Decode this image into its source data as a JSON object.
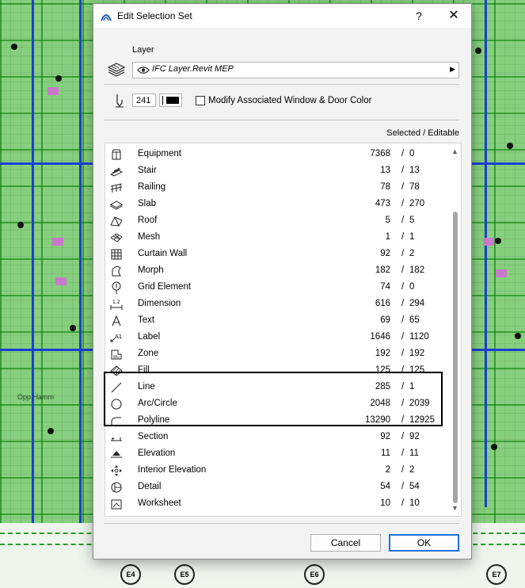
{
  "dialog": {
    "title": "Edit Selection Set",
    "help_label": "?",
    "close_label": "✕"
  },
  "layer": {
    "heading": "Layer",
    "value": "IFC Layer.Revit MEP"
  },
  "pen": {
    "number": "241",
    "checkbox_label": "Modify Associated Window & Door Color",
    "checkbox_checked": false
  },
  "list": {
    "column_header": "Selected / Editable",
    "rows": [
      {
        "icon": "equipment-icon",
        "name": "Equipment",
        "selected": "7368",
        "editable": "0"
      },
      {
        "icon": "stair-icon",
        "name": "Stair",
        "selected": "13",
        "editable": "13"
      },
      {
        "icon": "railing-icon",
        "name": "Railing",
        "selected": "78",
        "editable": "78"
      },
      {
        "icon": "slab-icon",
        "name": "Slab",
        "selected": "473",
        "editable": "270"
      },
      {
        "icon": "roof-icon",
        "name": "Roof",
        "selected": "5",
        "editable": "5"
      },
      {
        "icon": "mesh-icon",
        "name": "Mesh",
        "selected": "1",
        "editable": "1"
      },
      {
        "icon": "curtain-wall-icon",
        "name": "Curtain Wall",
        "selected": "92",
        "editable": "2"
      },
      {
        "icon": "morph-icon",
        "name": "Morph",
        "selected": "182",
        "editable": "182"
      },
      {
        "icon": "grid-element-icon",
        "name": "Grid Element",
        "selected": "74",
        "editable": "0"
      },
      {
        "icon": "dimension-icon",
        "name": "Dimension",
        "selected": "616",
        "editable": "294"
      },
      {
        "icon": "text-icon",
        "name": "Text",
        "selected": "69",
        "editable": "65"
      },
      {
        "icon": "label-icon",
        "name": "Label",
        "selected": "1646",
        "editable": "1120"
      },
      {
        "icon": "zone-icon",
        "name": "Zone",
        "selected": "192",
        "editable": "192"
      },
      {
        "icon": "fill-icon",
        "name": "Fill",
        "selected": "125",
        "editable": "125"
      },
      {
        "icon": "line-icon",
        "name": "Line",
        "selected": "285",
        "editable": "1"
      },
      {
        "icon": "arc-circle-icon",
        "name": "Arc/Circle",
        "selected": "2048",
        "editable": "2039"
      },
      {
        "icon": "polyline-icon",
        "name": "Polyline",
        "selected": "13290",
        "editable": "12925"
      },
      {
        "icon": "section-icon",
        "name": "Section",
        "selected": "92",
        "editable": "92"
      },
      {
        "icon": "elevation-icon",
        "name": "Elevation",
        "selected": "11",
        "editable": "11"
      },
      {
        "icon": "interior-elevation-icon",
        "name": "Interior Elevation",
        "selected": "2",
        "editable": "2"
      },
      {
        "icon": "detail-icon",
        "name": "Detail",
        "selected": "54",
        "editable": "54"
      },
      {
        "icon": "worksheet-icon",
        "name": "Worksheet",
        "selected": "10",
        "editable": "10"
      }
    ],
    "separator": "/"
  },
  "buttons": {
    "cancel": "Cancel",
    "ok": "OK"
  },
  "background": {
    "grid_bubbles": [
      "E4",
      "E5",
      "E6",
      "E7"
    ],
    "canvas_text": "Opp Hamm"
  },
  "colors": {
    "canvas_green": "#86cf7e",
    "wall_blue": "#1a3fd6",
    "ok_border": "#1e72d8",
    "highlight_box": "#000000"
  }
}
